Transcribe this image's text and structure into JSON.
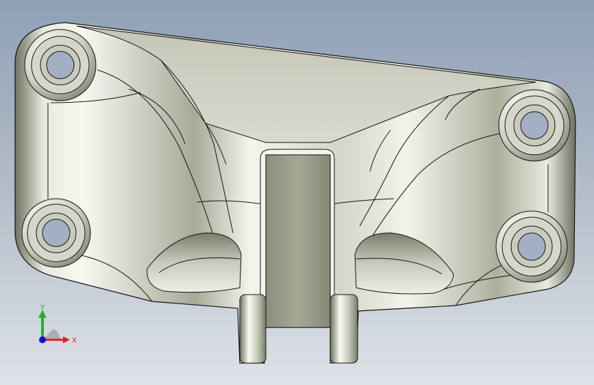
{
  "viewport": {
    "background_top": "#8fa0b6",
    "background_bottom": "#dfe3e8",
    "model_fill": "#cfd0c6",
    "model_edge": "#111111"
  },
  "triad": {
    "x_label": "X",
    "y_label": "Y",
    "x_color": "#e02020",
    "y_color": "#25b025",
    "z_color": "#1010d0"
  }
}
